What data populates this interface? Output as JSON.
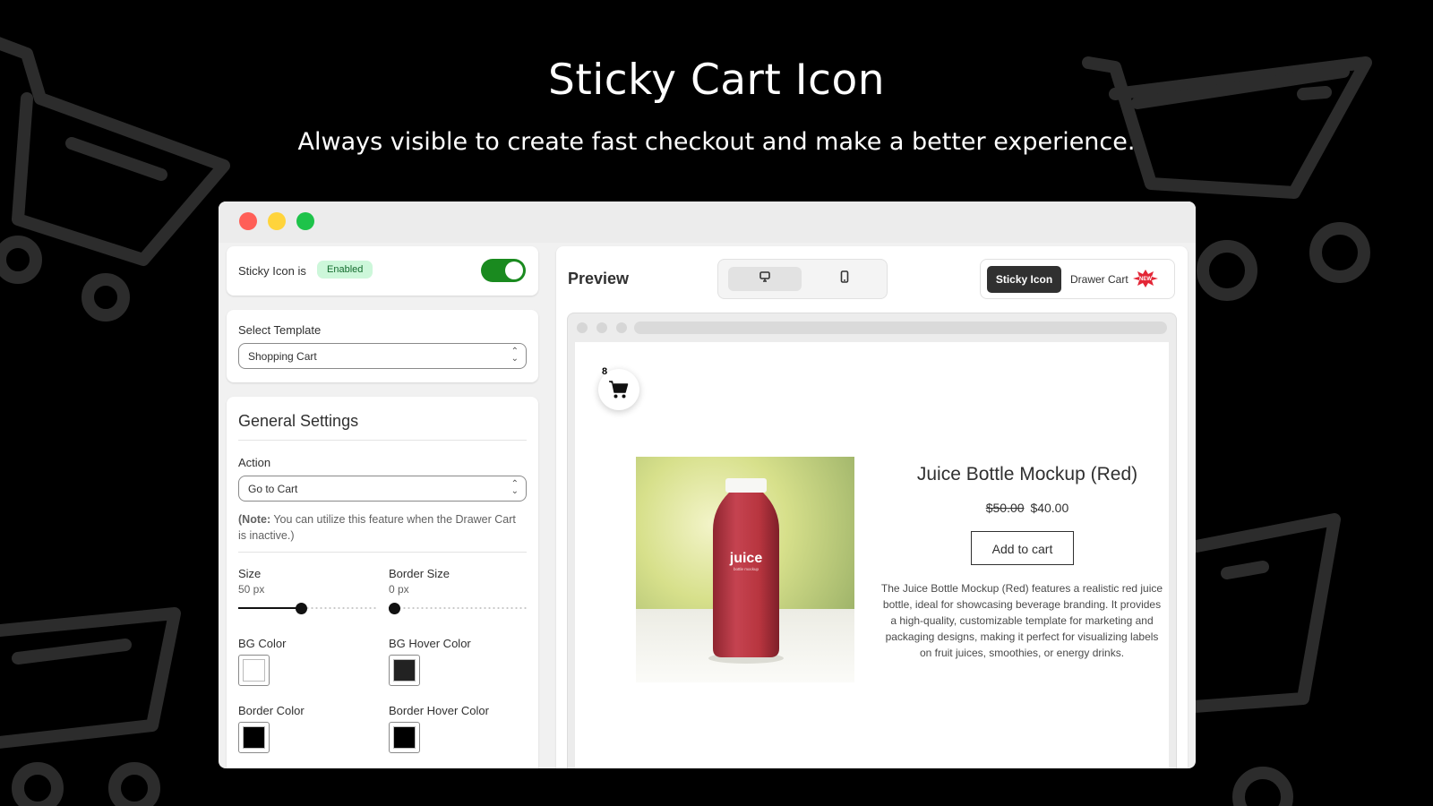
{
  "hero": {
    "title": "Sticky Cart Icon",
    "subtitle": "Always visible to create fast checkout and make a better experience."
  },
  "colors": {
    "background": "#000000",
    "toggle_on": "#1a8a1f",
    "enabled_badge_bg": "#cdf7da",
    "product_red": "#b8353f"
  },
  "settings": {
    "status_label": "Sticky Icon is",
    "status_badge": "Enabled",
    "toggle_on": true,
    "template_label": "Select Template",
    "template_value": "Shopping Cart",
    "general_title": "General Settings",
    "action_label": "Action",
    "action_value": "Go to Cart",
    "note_prefix": "(Note:",
    "note_text": " You can utilize this feature when the Drawer Cart is inactive.)",
    "size_label": "Size",
    "size_value": "50 px",
    "size_level": 0.45,
    "border_size_label": "Border Size",
    "border_size_value": "0 px",
    "border_size_level": 0.0,
    "bg_color_label": "BG Color",
    "bg_hover_color_label": "BG Hover Color",
    "border_color_label": "Border Color",
    "border_hover_color_label": "Border Hover Color",
    "bg_color": "#ffffff",
    "bg_hover_color": "#222222",
    "border_color": "#000000",
    "border_hover_color": "#000000"
  },
  "preview": {
    "title": "Preview",
    "device_icons": [
      "desktop-icon",
      "mobile-icon"
    ],
    "mode_active": "Sticky Icon",
    "mode_other": "Drawer Cart",
    "new_badge": "NEW",
    "cart_count": "8",
    "product": {
      "name": "Juice Bottle Mockup (Red)",
      "old_price": "$50.00",
      "price": "$40.00",
      "button": "Add to cart",
      "description": "The Juice Bottle Mockup (Red) features a realistic red juice bottle, ideal for showcasing beverage branding. It provides a high-quality, customizable template for marketing and packaging designs, making it perfect for visualizing labels on fruit juices, smoothies, or energy drinks.",
      "bottle_label": "juice",
      "bottle_sublabel": "bottle mockup"
    }
  }
}
